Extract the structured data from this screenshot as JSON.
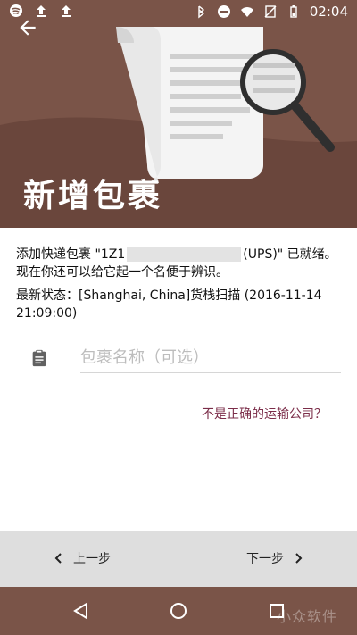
{
  "statusbar": {
    "time": "02:04",
    "left_icons": [
      "spotify-icon",
      "upload-icon",
      "upload-icon"
    ],
    "right_icons": [
      "bluetooth-icon",
      "dnd-icon",
      "wifi-icon",
      "no-sim-icon",
      "battery-icon"
    ]
  },
  "header": {
    "title": "新增包裹",
    "bg_color": "#7a5448",
    "accent": "#7b2d49"
  },
  "content": {
    "intro_prefix": "添加快递包裹 \"1Z1",
    "intro_suffix": "(UPS)\" 已就绪。现在你还可以给它起一个名便于辨识。",
    "latest_label": "最新状态：",
    "latest_value": "[Shanghai, China]货栈扫描 (2016-11-14 21:09:00)",
    "name_placeholder": "包裹名称（可选）",
    "wrong_carrier": "不是正确的运输公司？"
  },
  "navbar": {
    "prev": "上一步",
    "next": "下一步"
  },
  "watermark": "小众软件"
}
